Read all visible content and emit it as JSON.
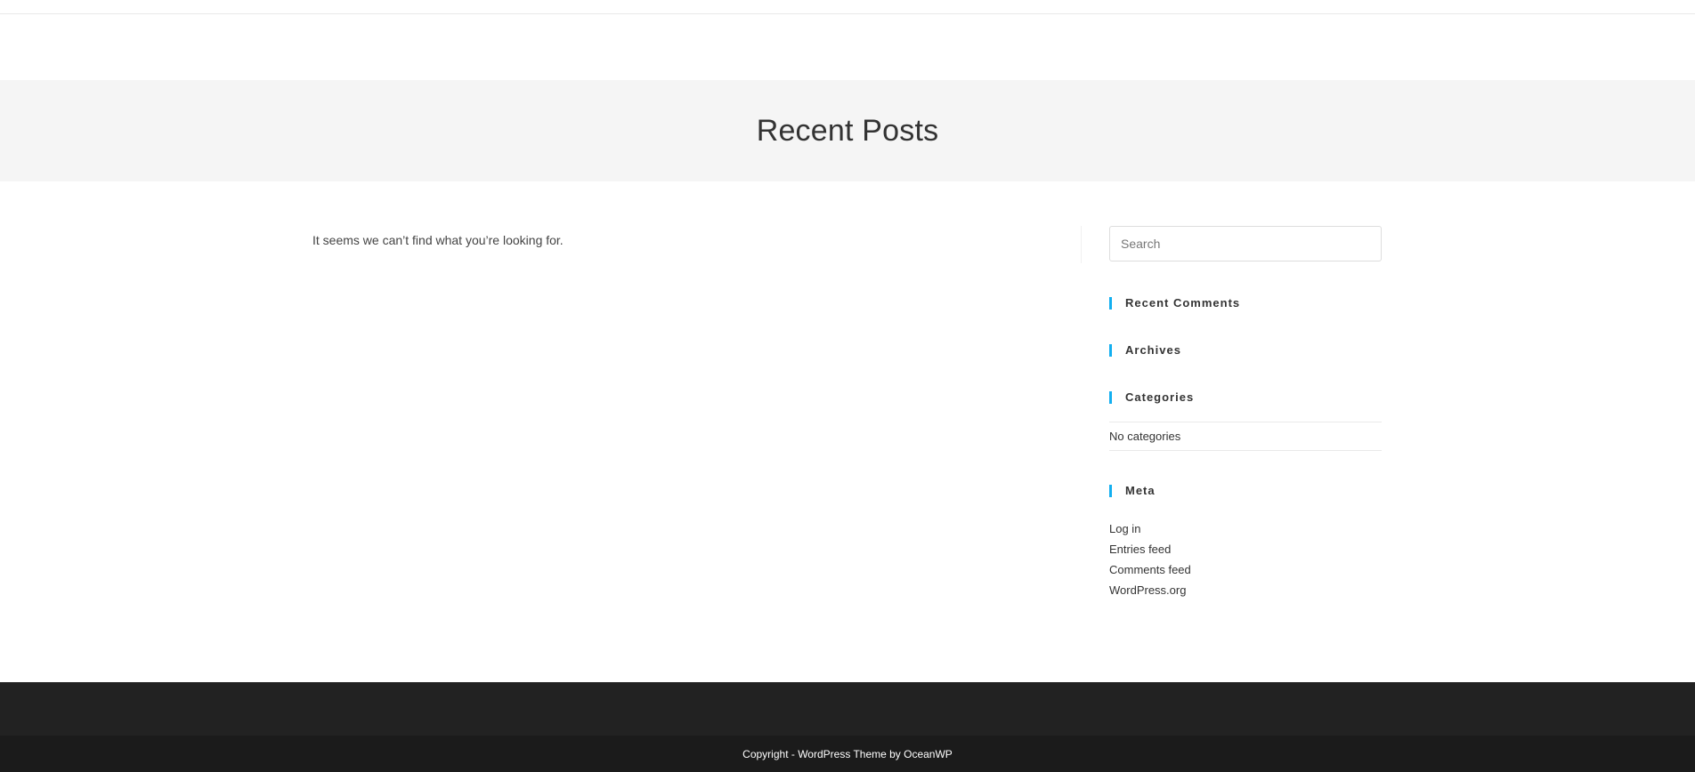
{
  "banner": {
    "title": "Recent Posts"
  },
  "content": {
    "message": "It seems we can’t find what you’re looking for."
  },
  "sidebar": {
    "search_placeholder": "Search",
    "recent_comments_title": "Recent Comments",
    "archives_title": "Archives",
    "categories_title": "Categories",
    "categories_empty": "No categories",
    "meta_title": "Meta",
    "meta_links": [
      {
        "label": "Log in"
      },
      {
        "label": "Entries feed"
      },
      {
        "label": "Comments feed"
      },
      {
        "label": "WordPress.org"
      }
    ]
  },
  "footer": {
    "copyright": "Copyright - WordPress Theme by OceanWP"
  },
  "colors": {
    "accent": "#13aff0",
    "banner_bg": "#f5f5f5",
    "footer_bg": "#222222",
    "footer_bottom_bg": "#1b1b1b"
  }
}
